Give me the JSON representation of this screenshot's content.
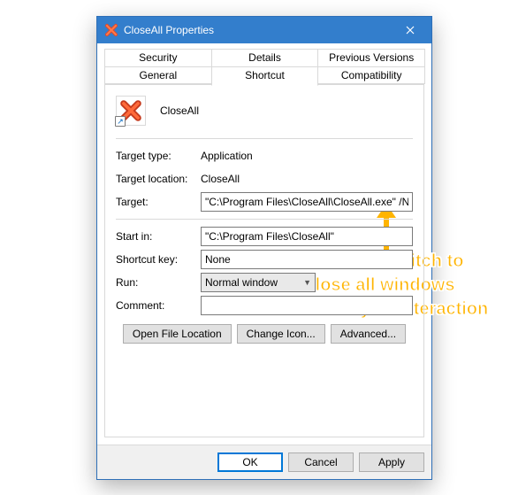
{
  "window": {
    "title": "CloseAll Properties"
  },
  "tabs": {
    "row1": [
      "Security",
      "Details",
      "Previous Versions"
    ],
    "row2": [
      "General",
      "Shortcut",
      "Compatibility"
    ],
    "active": "Shortcut"
  },
  "app": {
    "name": "CloseAll"
  },
  "labels": {
    "target_type": "Target type:",
    "target_location": "Target location:",
    "target": "Target:",
    "start_in": "Start in:",
    "shortcut_key": "Shortcut key:",
    "run": "Run:",
    "comment": "Comment:"
  },
  "values": {
    "target_type": "Application",
    "target_location": "CloseAll",
    "target": "\"C:\\Program Files\\CloseAll\\CloseAll.exe\" /NOUI",
    "start_in": "\"C:\\Program Files\\CloseAll\"",
    "shortcut_key": "None",
    "run": "Normal window",
    "comment": ""
  },
  "buttons": {
    "open_file_location": "Open File Location",
    "change_icon": "Change Icon...",
    "advanced": "Advanced...",
    "ok": "OK",
    "cancel": "Cancel",
    "apply": "Apply"
  },
  "annotation": {
    "line1": "add /NOUI switch to",
    "line2": "close all windows",
    "line3": "without any UI interaction"
  }
}
